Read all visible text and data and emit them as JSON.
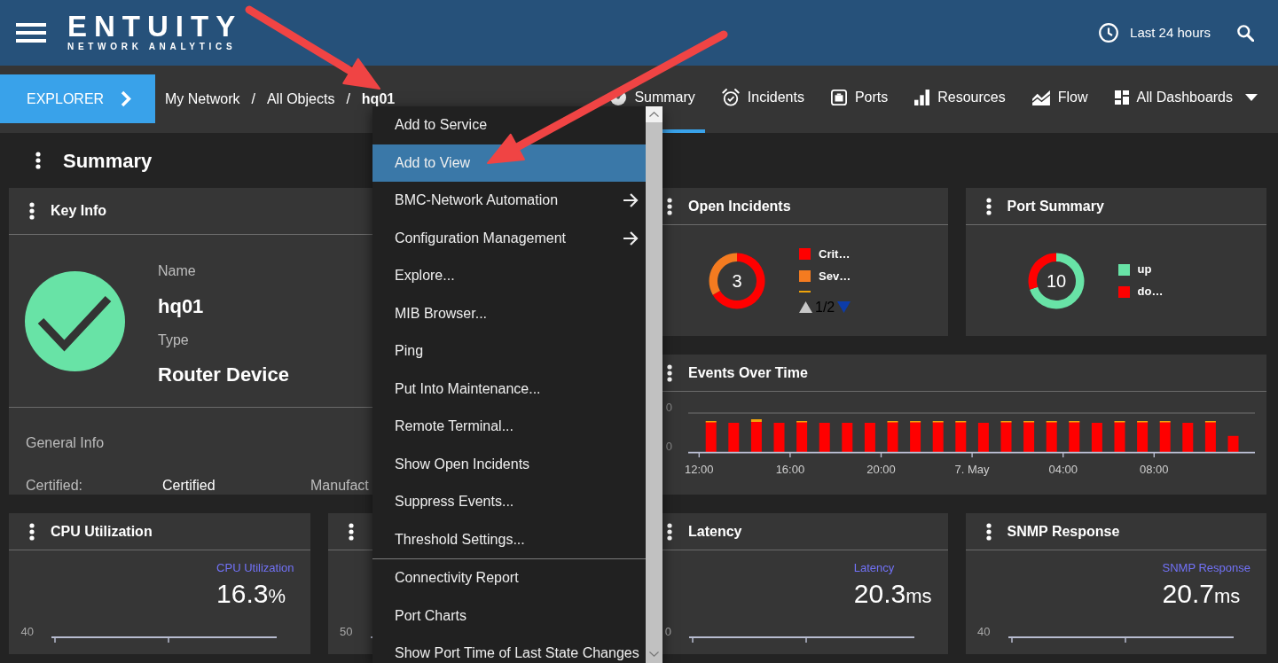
{
  "header": {
    "logo": {
      "wordmark": "ENTUITY",
      "tagline": "NETWORK ANALYTICS"
    },
    "time_range": "Last 24 hours"
  },
  "navigation": {
    "explorer_button": "EXPLORER",
    "breadcrumb": [
      {
        "kind": "link",
        "label": "My Network"
      },
      {
        "kind": "separator",
        "label": "/"
      },
      {
        "kind": "link",
        "label": "All Objects"
      },
      {
        "kind": "separator",
        "label": "/"
      },
      {
        "kind": "current",
        "label": "hq01"
      }
    ],
    "tabs": [
      {
        "label": "Summary",
        "kind": "tab",
        "selected": true
      },
      {
        "label": "Incidents",
        "kind": "tab",
        "selected": false
      },
      {
        "label": "Ports",
        "kind": "tab",
        "selected": false
      },
      {
        "label": "Resources",
        "kind": "tab",
        "selected": false
      },
      {
        "label": "Flow",
        "kind": "tab",
        "selected": false
      },
      {
        "label": "All Dashboards",
        "kind": "dropdown",
        "selected": false
      }
    ]
  },
  "page_title": "Summary",
  "key_info": {
    "title": "Key Info",
    "healthy": true,
    "fields": [
      {
        "label": "Name",
        "value": "hq01"
      },
      {
        "label": "Type",
        "value": "Router Device"
      }
    ],
    "section_title": "General Info",
    "general_info": [
      {
        "label": "Certified:",
        "value": "Certified"
      },
      {
        "label": "Manufact"
      }
    ]
  },
  "open_incidents": {
    "title": "Open Incidents",
    "total": "3",
    "legend": [
      {
        "color": "#ff0000"
      },
      {
        "color": "#f47b20"
      },
      {
        "color": "#f0a30a"
      }
    ],
    "pager": {
      "text": "1/2",
      "prev_disabled": true,
      "next_disabled": false
    },
    "chart_data": {
      "type": "donut",
      "categories": [
        "Crit…",
        "Sev…"
      ],
      "values": [
        66.7,
        33.3
      ]
    }
  },
  "port_summary": {
    "title": "Port Summary",
    "total": "10",
    "legend": [
      {
        "color": "#68e3a6"
      },
      {
        "color": "#ff0000"
      }
    ],
    "chart_data": {
      "type": "donut",
      "categories": [
        "up",
        "do…"
      ],
      "values": [
        70,
        30
      ]
    }
  },
  "events_over_time": {
    "title": "Events Over Time",
    "y_labels": [
      "0",
      "0"
    ],
    "x_labels": [
      "12:00",
      "16:00",
      "20:00",
      "7. May",
      "04:00",
      "08:00"
    ]
  },
  "metric_cards": [
    {
      "title": "CPU Utilization",
      "series_label": "CPU Utilization",
      "value": "16.3",
      "unit": "%",
      "axis_label": "40"
    },
    {
      "axis_label": "50"
    },
    {
      "title": "Latency",
      "series_label": "Latency",
      "value": "20.3",
      "unit": "ms",
      "axis_label": "0"
    },
    {
      "title": "SNMP Response",
      "series_label": "SNMP Response",
      "value": "20.7",
      "unit": "ms",
      "axis_label": "40"
    }
  ],
  "context_menu": {
    "groups": [
      {
        "items": [
          {
            "label": "Add to Service",
            "selected": false,
            "submenu": false
          },
          {
            "label": "Add to View",
            "selected": true,
            "submenu": false
          },
          {
            "label": "BMC-Network Automation",
            "selected": false,
            "submenu": true
          },
          {
            "label": "Configuration Management",
            "selected": false,
            "submenu": true
          },
          {
            "label": "Explore...",
            "selected": false,
            "submenu": false
          },
          {
            "label": "MIB Browser...",
            "selected": false,
            "submenu": false
          },
          {
            "label": "Ping",
            "selected": false,
            "submenu": false
          },
          {
            "label": "Put Into Maintenance...",
            "selected": false,
            "submenu": false
          },
          {
            "label": "Remote Terminal...",
            "selected": false,
            "submenu": false
          },
          {
            "label": "Show Open Incidents",
            "selected": false,
            "submenu": false
          },
          {
            "label": "Suppress Events...",
            "selected": false,
            "submenu": false
          },
          {
            "label": "Threshold Settings...",
            "selected": false,
            "submenu": false
          }
        ]
      },
      {
        "items": [
          {
            "label": "Connectivity Report",
            "selected": false,
            "submenu": false
          },
          {
            "label": "Port Charts",
            "selected": false,
            "submenu": false
          },
          {
            "label": "Show Port Time of Last State Changes",
            "selected": false,
            "submenu": false
          }
        ]
      }
    ]
  },
  "callouts": [
    {
      "kind": "arrow"
    },
    {
      "kind": "arrow"
    }
  ]
}
